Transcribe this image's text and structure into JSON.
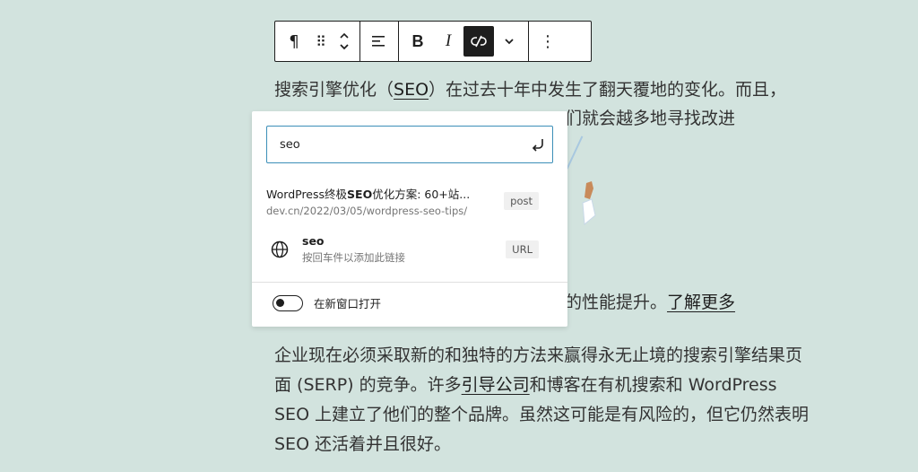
{
  "toolbar": {
    "paragraph_icon": "¶",
    "drag_icon": "⠿",
    "align_icon": "align-left",
    "bold_label": "B",
    "italic_label": "I",
    "unlink_icon": "unlink-icon",
    "more_icon": "chevron-down",
    "options_icon": "⋮"
  },
  "content": {
    "p1_before": "搜索引擎优化（",
    "p1_link": "SEO",
    "p1_after": "）在过去十年中发生了翻天覆地的变化。而且，",
    "p1_line2": "们就会越多地寻找改进",
    "p1_line3a": "的性能提升。",
    "p1_line3_link": "了解更多",
    "p2_a": "企业现在必须采取新的和独特的方法来赢得永无止境的搜索引擎结果页面 (SERP) 的竞争。许多",
    "p2_link": "引导公司",
    "p2_b": "和博客在有机搜索和 WordPress SEO 上建立了他们的整个品牌。虽然这可能是有风险的，但它仍然表明 SEO 还活着并且很好。"
  },
  "link_popover": {
    "search_value": "seo",
    "results": [
      {
        "title_pre": "WordPress终极",
        "title_bold": "SEO",
        "title_post": "优化方案: 60+站...",
        "url": "dev.cn/2022/03/05/wordpress-seo-tips/",
        "tag": "post"
      },
      {
        "title": "seo",
        "hint": "按回车件以添加此链接",
        "tag": "URL"
      }
    ],
    "new_tab_label": "在新窗口打开",
    "new_tab_on": false
  }
}
